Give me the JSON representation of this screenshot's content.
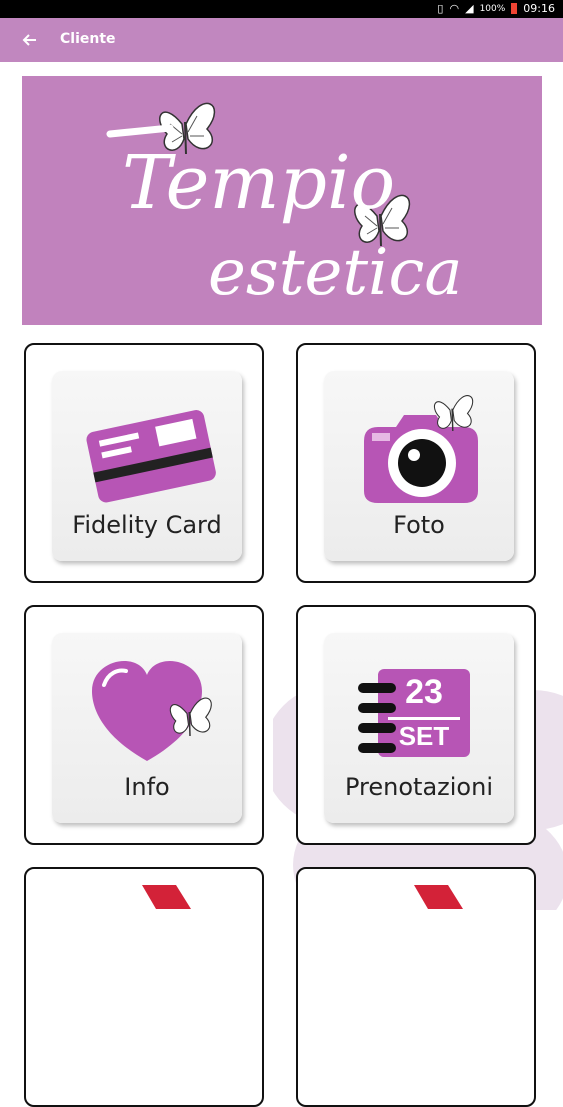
{
  "status": {
    "battery": "100%",
    "time": "09:16"
  },
  "app_bar": {
    "title": "Cliente"
  },
  "banner": {
    "logo_text": "Tempio estetica"
  },
  "tiles": [
    {
      "label": "Fidelity Card",
      "icon": "fidelity-card-icon"
    },
    {
      "label": "Foto",
      "icon": "camera-icon"
    },
    {
      "label": "Info",
      "icon": "heart-icon"
    },
    {
      "label": "Prenotazioni",
      "icon": "calendar-icon"
    }
  ],
  "calendar": {
    "day": "23",
    "month": "SET"
  },
  "colors": {
    "accent": "#c187bf",
    "banner": "#c182bd",
    "icon_purple": "#b755b5"
  }
}
